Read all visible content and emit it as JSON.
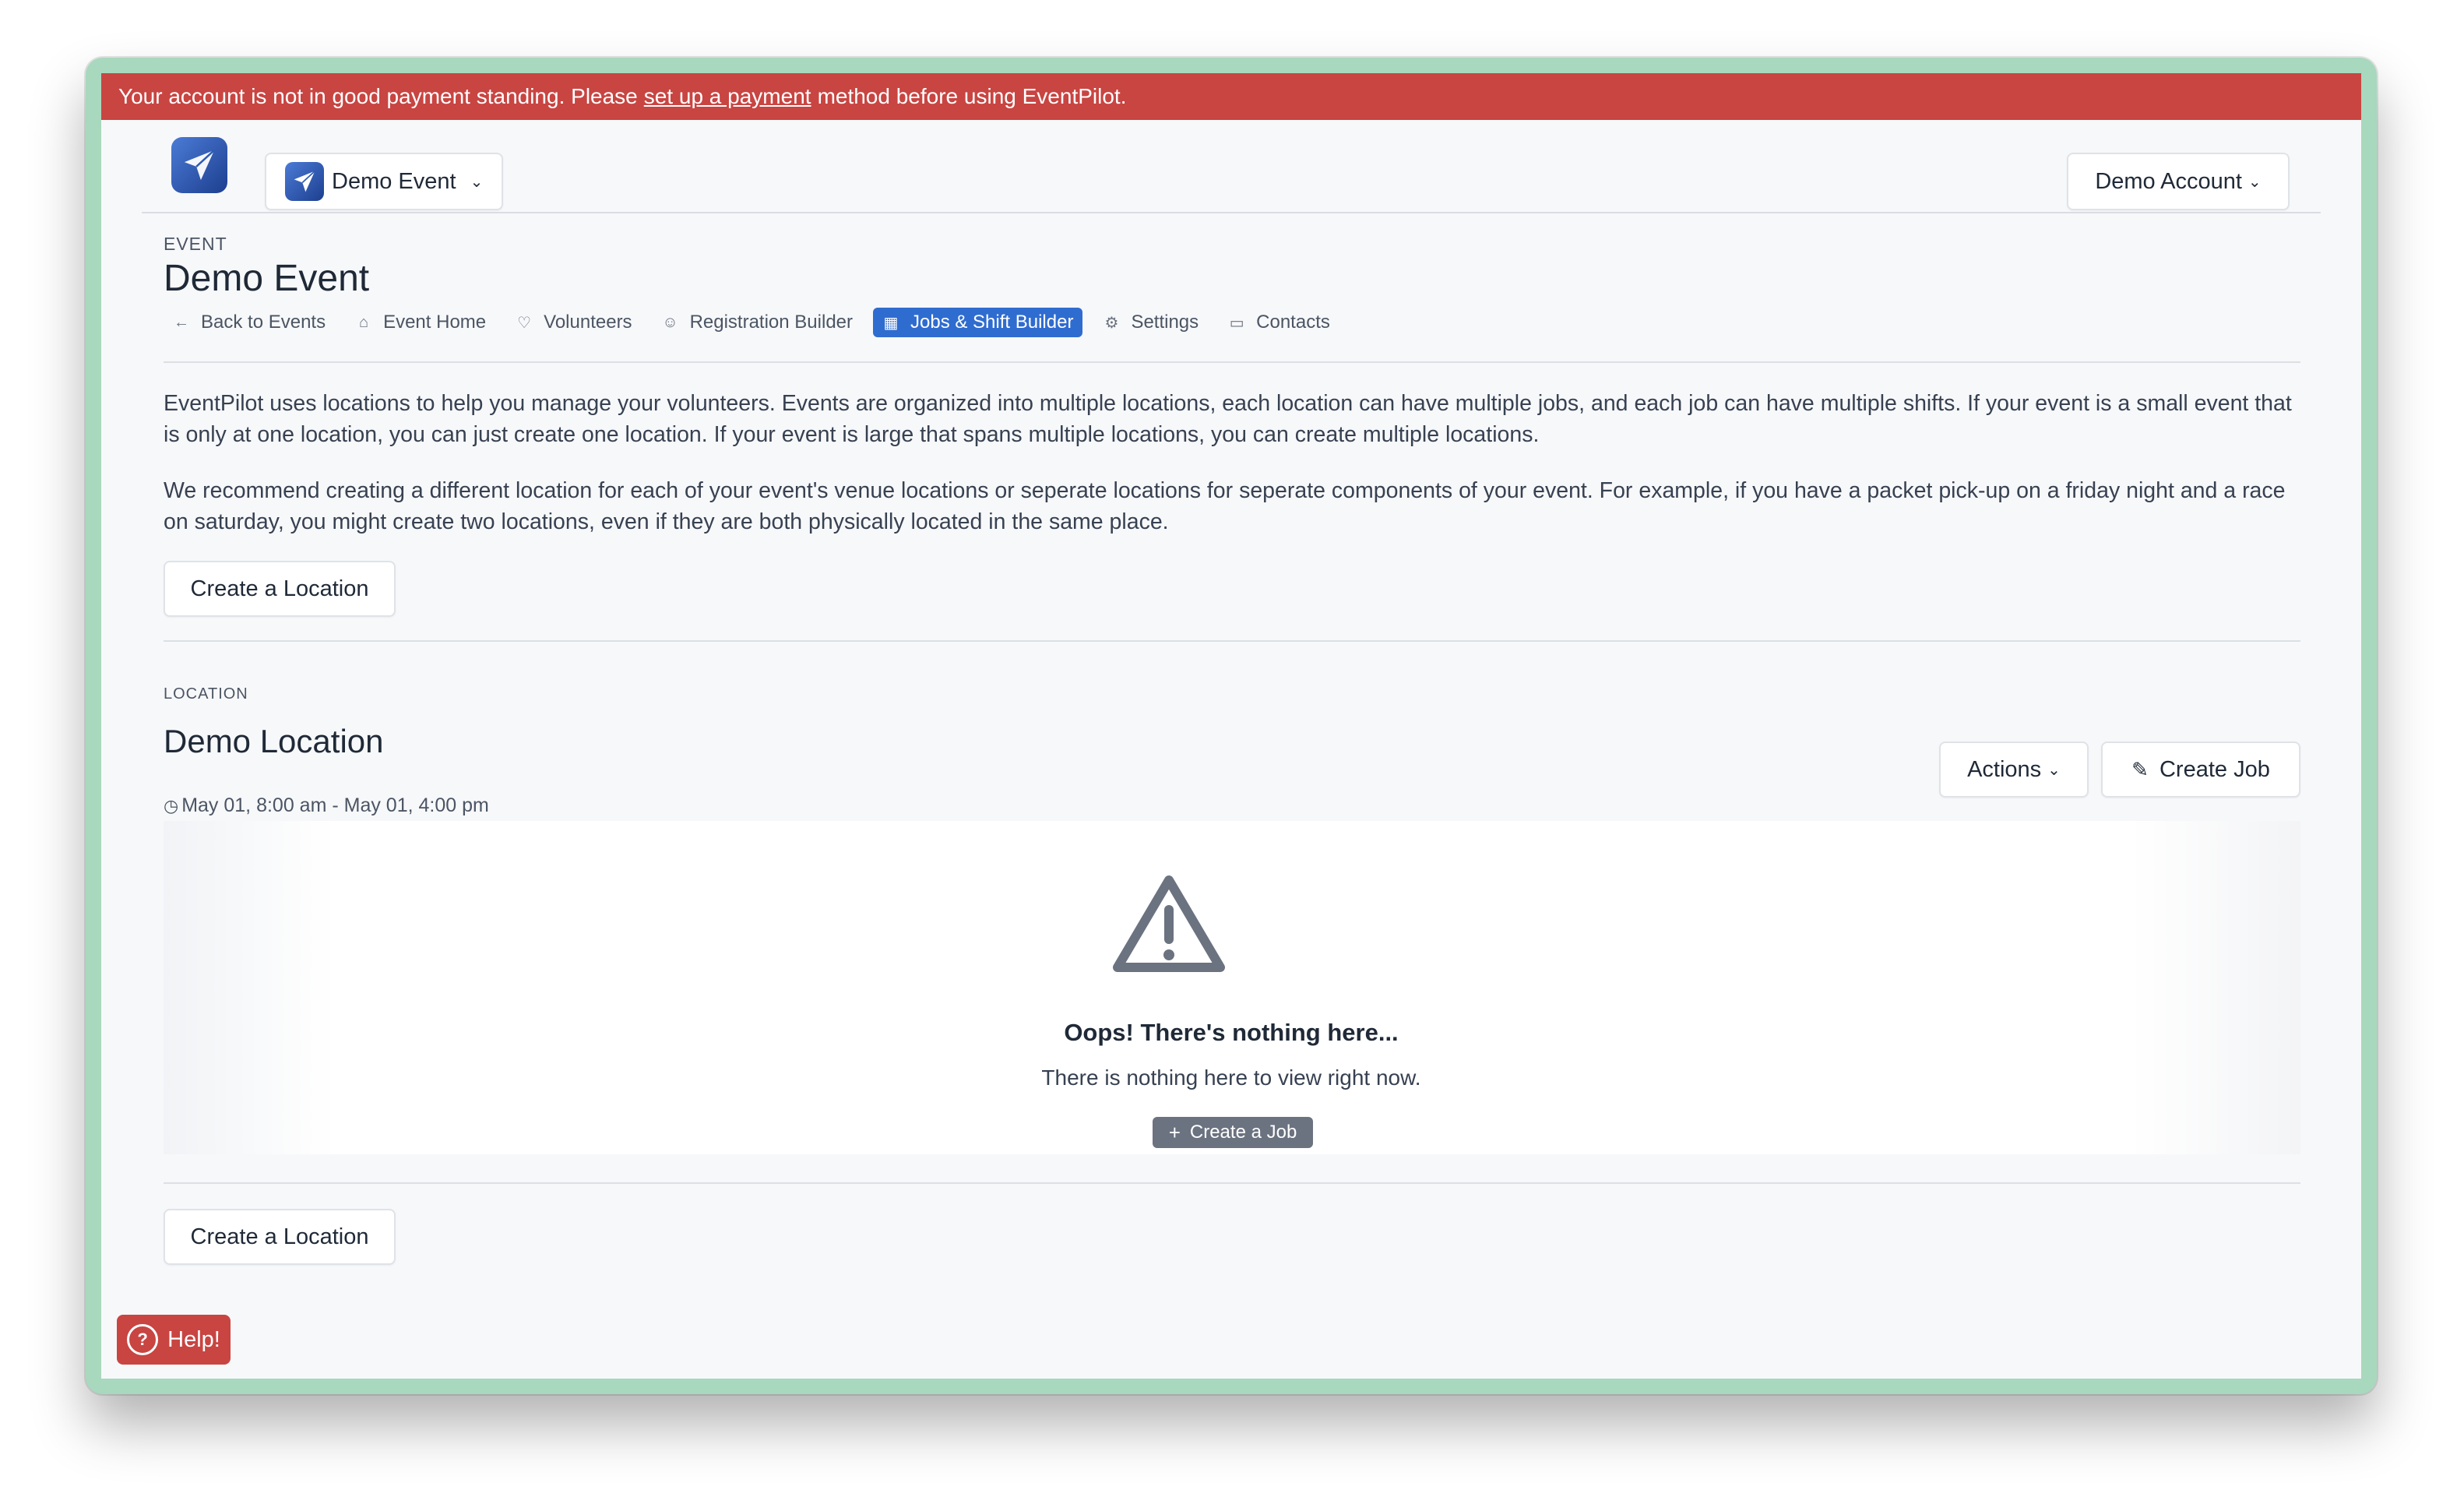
{
  "banner": {
    "text_before": "Your account is not in good payment standing. Please",
    "link": "set up a payment",
    "text_after": "method before using EventPilot."
  },
  "header": {
    "logo_icon": "paper-plane-icon",
    "event_switcher": "Demo Event",
    "account_menu": "Demo Account"
  },
  "event": {
    "label": "EVENT",
    "title": "Demo Event",
    "tabs": [
      {
        "label": "Back to Events",
        "icon": "arrow-left-icon"
      },
      {
        "label": "Event Home",
        "icon": "home-icon"
      },
      {
        "label": "Volunteers",
        "icon": "heart-icon"
      },
      {
        "label": "Registration Builder",
        "icon": "smiley-icon"
      },
      {
        "label": "Jobs & Shift Builder",
        "icon": "grid-icon",
        "active": true
      },
      {
        "label": "Settings",
        "icon": "gear-icon"
      },
      {
        "label": "Contacts",
        "icon": "briefcase-icon"
      }
    ]
  },
  "intro": {
    "p1": "EventPilot uses locations to help you manage your volunteers. Events are organized into multiple locations, each location can have multiple jobs, and each job can have multiple shifts. If your event is a small event that is only at one location, you can just create one location. If your event is large that spans multiple locations, you can create multiple locations.",
    "p2": "We recommend creating a different location for each of your event's venue locations or seperate locations for seperate components of your event. For example, if you have a packet pick-up on a friday night and a race on saturday, you might create two locations, even if they are both physically located in the same place."
  },
  "buttons": {
    "create_location": "Create a Location",
    "actions": "Actions",
    "create_job": "Create Job",
    "help": "Help!"
  },
  "location": {
    "label": "LOCATION",
    "title": "Demo Location",
    "time": "May 01, 8:00 am - May 01, 4:00 pm"
  },
  "empty_state": {
    "icon": "warning-triangle-icon",
    "title": "Oops! There's nothing here...",
    "subtitle": "There is nothing here to view right now.",
    "button": "Create a Job"
  },
  "colors": {
    "banner": "#c84542",
    "active_tab": "#2f6cd0",
    "window_frame": "#a8d8bd"
  }
}
